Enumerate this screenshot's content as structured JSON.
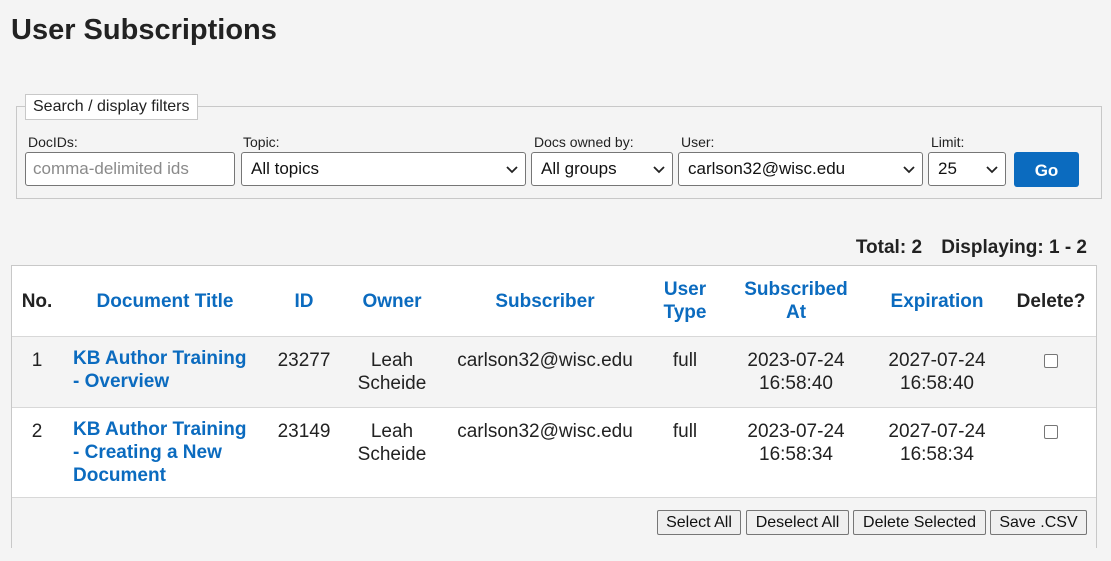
{
  "page": {
    "title": "User Subscriptions"
  },
  "filters": {
    "legend": "Search / display filters",
    "docids": {
      "label": "DocIDs:",
      "placeholder": "comma-delimited ids",
      "value": ""
    },
    "topic": {
      "label": "Topic:",
      "selected": "All topics"
    },
    "owned_by": {
      "label": "Docs owned by:",
      "selected": "All groups"
    },
    "user": {
      "label": "User:",
      "selected": "carlson32@wisc.edu"
    },
    "limit": {
      "label": "Limit:",
      "selected": "25"
    },
    "go_label": "Go"
  },
  "summary": {
    "total": "Total: 2",
    "displaying": "Displaying: 1 - 2"
  },
  "table": {
    "headers": {
      "no": "No.",
      "document_title": "Document Title",
      "id": "ID",
      "owner": "Owner",
      "subscriber": "Subscriber",
      "user_type_line1": "User",
      "user_type_line2": "Type",
      "subscribed_at_line1": "Subscribed",
      "subscribed_at_line2": "At",
      "expiration": "Expiration",
      "delete": "Delete?"
    },
    "rows": [
      {
        "no": "1",
        "title_lines": [
          "KB Author Training",
          "- Overview"
        ],
        "id": "23277",
        "owner_lines": [
          "Leah",
          "Scheide"
        ],
        "subscriber": "carlson32@wisc.edu",
        "user_type": "full",
        "subscribed_lines": [
          "2023-07-24",
          "16:58:40"
        ],
        "expiration_lines": [
          "2027-07-24",
          "16:58:40"
        ],
        "delete_checked": false
      },
      {
        "no": "2",
        "title_lines": [
          "KB Author Training",
          "- Creating a New",
          "Document"
        ],
        "id": "23149",
        "owner_lines": [
          "Leah",
          "Scheide"
        ],
        "subscriber": "carlson32@wisc.edu",
        "user_type": "full",
        "subscribed_lines": [
          "2023-07-24",
          "16:58:34"
        ],
        "expiration_lines": [
          "2027-07-24",
          "16:58:34"
        ],
        "delete_checked": false
      }
    ]
  },
  "actions": {
    "select_all": "Select All",
    "deselect_all": "Deselect All",
    "delete_selected": "Delete Selected",
    "save_csv": "Save .CSV"
  },
  "colors": {
    "link": "#0b6bbf",
    "go_button": "#0b6bbf",
    "background": "#f4f4f4"
  },
  "icons": {
    "dropdown": "chevron-down-icon",
    "checkbox": "checkbox-icon"
  }
}
